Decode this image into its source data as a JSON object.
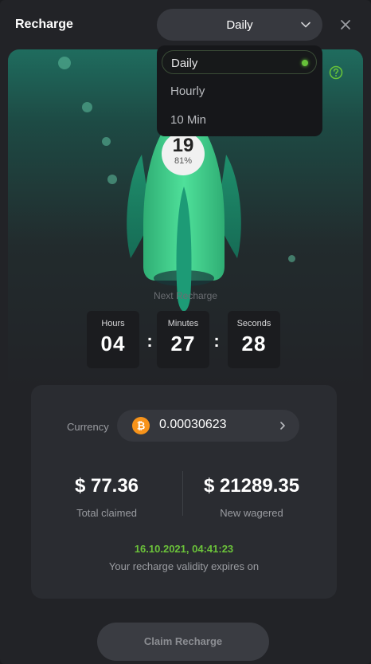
{
  "header": {
    "title": "Recharge",
    "period_selected": "Daily",
    "period_options": [
      {
        "label": "Daily",
        "selected": true
      },
      {
        "label": "Hourly",
        "selected": false
      },
      {
        "label": "10 Min",
        "selected": false
      }
    ]
  },
  "level": {
    "value": "19",
    "progress_text": "81%"
  },
  "countdown": {
    "label": "Next Recharge",
    "hours_label": "Hours",
    "hours": "04",
    "minutes_label": "Minutes",
    "minutes": "27",
    "seconds_label": "Seconds",
    "seconds": "28",
    "separator": ":"
  },
  "card": {
    "currency_label": "Currency",
    "currency_icon": "bitcoin-icon",
    "currency_amount": "0.00030623",
    "total_claimed": "$ 77.36",
    "total_claimed_label": "Total claimed",
    "new_wagered": "$ 21289.35",
    "new_wagered_label": "New wagered",
    "expiry_date": "16.10.2021, 04:41:23",
    "expiry_label": "Your recharge validity expires on"
  },
  "claim_button": "Claim Recharge",
  "colors": {
    "accent_green": "#67c23a",
    "bitcoin_orange": "#f7931a",
    "rocket_green": "#3ecf8e"
  },
  "icons": [
    "chevron-down-icon",
    "close-icon",
    "help-icon",
    "bitcoin-icon",
    "chevron-right-icon",
    "rocket-icon"
  ]
}
